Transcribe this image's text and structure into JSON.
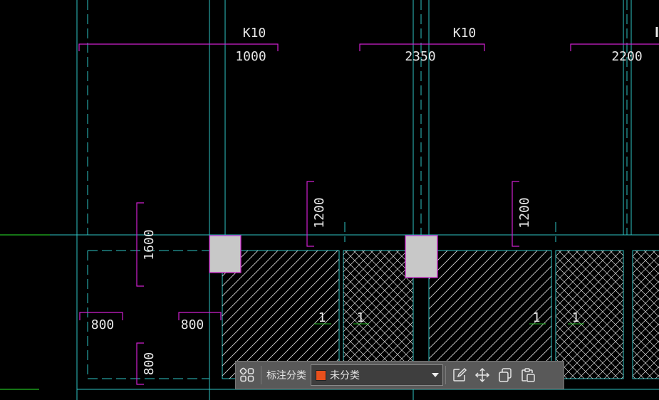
{
  "drawing": {
    "column_labels": [
      "K10",
      "K10"
    ],
    "horizontal_dims": [
      "1000",
      "2350",
      "2200"
    ],
    "vertical_dims": [
      "1600",
      "1200",
      "1200",
      "800"
    ],
    "footing_dims": [
      "800",
      "800"
    ],
    "section_marks": [
      "1",
      "1",
      "1",
      "1"
    ]
  },
  "toolbar": {
    "category_label": "标注分类",
    "category_value": "未分类",
    "category_color": "#e8501c"
  },
  "colors": {
    "background": "#000000",
    "grid_axis": "#3cc",
    "dimension": "#d020d0",
    "text": "#e8e8e8",
    "column_fill": "#c8c8c8",
    "axis_green": "#22bb22"
  },
  "icons": [
    "grid-layout-icon",
    "edit-icon",
    "move-icon",
    "copy-icon",
    "paste-icon"
  ]
}
